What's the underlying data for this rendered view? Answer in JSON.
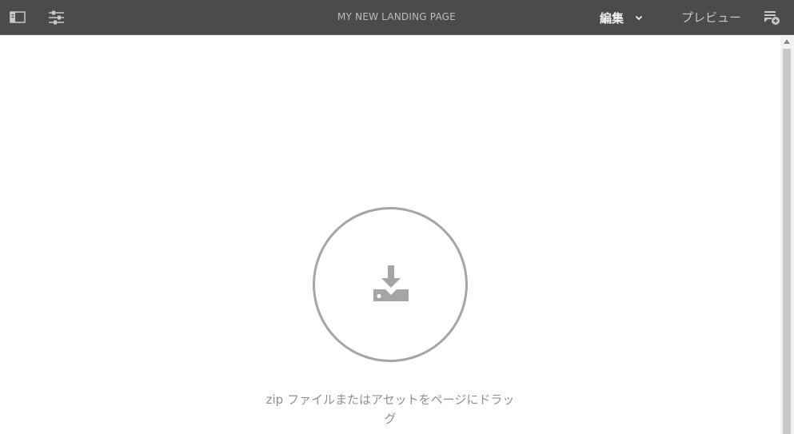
{
  "header": {
    "title": "MY NEW LANDING PAGE",
    "mode_label": "編集",
    "preview_label": "プレビュー",
    "icons": {
      "side_panel": "side-panel-icon",
      "properties": "sliders-icon",
      "mode_dropdown": "chevron-down-icon",
      "annotations": "annotation-icon"
    }
  },
  "main": {
    "drop_zone": {
      "icon": "download-tray-icon",
      "text": "zip ファイルまたはアセットをページにドラッグ"
    }
  },
  "colors": {
    "topbar": "#4b4b4b",
    "title_text": "#bdbdbd",
    "dropzone_border": "#a5a5a5",
    "dropzone_text": "#909090"
  }
}
